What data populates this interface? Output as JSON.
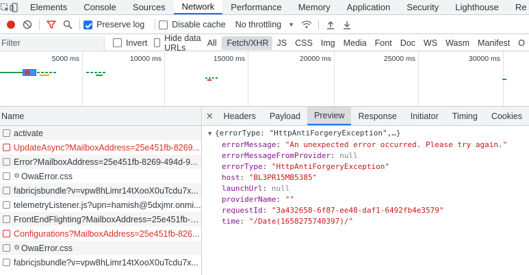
{
  "devtools_tabs": [
    "Elements",
    "Console",
    "Sources",
    "Network",
    "Performance",
    "Memory",
    "Application",
    "Security",
    "Lighthouse",
    "Re"
  ],
  "active_tab": "Network",
  "toolbar": {
    "preserve_log": "Preserve log",
    "disable_cache": "Disable cache",
    "throttling": "No throttling"
  },
  "filterbar": {
    "placeholder": "Filter",
    "invert": "Invert",
    "hide_data_urls": "Hide data URLs",
    "types": [
      "All",
      "Fetch/XHR",
      "JS",
      "CSS",
      "Img",
      "Media",
      "Font",
      "Doc",
      "WS",
      "Wasm",
      "Manifest",
      "O"
    ],
    "active_type": "Fetch/XHR"
  },
  "overview": {
    "ticks": [
      "5000 ms",
      "10000 ms",
      "15000 ms",
      "20000 ms",
      "25000 ms",
      "30000 ms"
    ]
  },
  "list": {
    "header": "Name",
    "rows": [
      {
        "name": "activate",
        "error": false,
        "icon": ""
      },
      {
        "name": "UpdateAsync?MailboxAddress=25e451fb-8269...",
        "error": true,
        "icon": ""
      },
      {
        "name": "Error?MailboxAddress=25e451fb-8269-494d-9...",
        "error": false,
        "icon": ""
      },
      {
        "name": "OwaError.css",
        "error": false,
        "icon": "gear-icon"
      },
      {
        "name": "fabricjsbundle?v=vpw8hLimr14tXooX0uTcdu7x...",
        "error": false,
        "icon": ""
      },
      {
        "name": "telemetryListener.js?upn=hamish@5dxjmr.onmi...",
        "error": false,
        "icon": ""
      },
      {
        "name": "FrontEndFlighting?MailboxAddress=25e451fb-8...",
        "error": false,
        "icon": ""
      },
      {
        "name": "Configurations?MailboxAddress=25e451fb-826...",
        "error": true,
        "icon": ""
      },
      {
        "name": "OwaError.css",
        "error": false,
        "icon": "gear-icon"
      },
      {
        "name": "fabricjsbundle?v=vpw8hLimr14tXooX0uTcdu7x...",
        "error": false,
        "icon": ""
      }
    ]
  },
  "detail": {
    "tabs": [
      "Headers",
      "Payload",
      "Preview",
      "Response",
      "Initiator",
      "Timing",
      "Cookies"
    ],
    "active_tab": "Preview",
    "summary_open": "{errorType: \"HttpAntiForgeryException\",…}",
    "fields": [
      {
        "key": "errorMessage",
        "value": "\"An unexpected error occurred. Please try again.\"",
        "kind": "string"
      },
      {
        "key": "errorMessageFromProvider",
        "value": "null",
        "kind": "null"
      },
      {
        "key": "errorType",
        "value": "\"HttpAntiForgeryException\"",
        "kind": "string"
      },
      {
        "key": "host",
        "value": "\"BL3PR15MB5385\"",
        "kind": "string"
      },
      {
        "key": "launchUrl",
        "value": "null",
        "kind": "null"
      },
      {
        "key": "providerName",
        "value": "\"\"",
        "kind": "string"
      },
      {
        "key": "requestId",
        "value": "\"3a432658-6f87-ee48-daf1-6492fb4e3579\"",
        "kind": "string"
      },
      {
        "key": "time",
        "value": "\"/Date(1658275740397)/\"",
        "kind": "string"
      }
    ]
  },
  "colors": {
    "accent": "#1a73e8",
    "record_red": "#d93025",
    "filter_red": "#d93025",
    "json_key": "#881391",
    "json_string": "#c41a16"
  }
}
